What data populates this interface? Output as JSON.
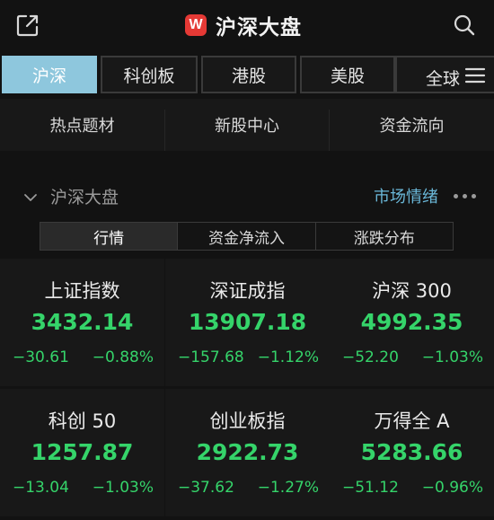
{
  "header": {
    "logo_text": "W",
    "title": "沪深大盘",
    "share_icon": "share-external-icon",
    "search_icon": "search-icon"
  },
  "market_tabs": [
    {
      "label": "沪深",
      "active": true
    },
    {
      "label": "科创板",
      "active": false
    },
    {
      "label": "港股",
      "active": false
    },
    {
      "label": "美股",
      "active": false
    },
    {
      "label": "全球",
      "active": false
    }
  ],
  "shortcuts": [
    "热点题材",
    "新股中心",
    "资金流向"
  ],
  "section": {
    "title": "沪深大盘",
    "link": "市场情绪"
  },
  "sub_tabs": [
    {
      "label": "行情",
      "active": true
    },
    {
      "label": "资金净流入",
      "active": false
    },
    {
      "label": "涨跌分布",
      "active": false
    }
  ],
  "indices": [
    {
      "name": "上证指数",
      "price": "3432.14",
      "change": "−30.61",
      "pct": "−0.88%"
    },
    {
      "name": "深证成指",
      "price": "13907.18",
      "change": "−157.68",
      "pct": "−1.12%"
    },
    {
      "name": "沪深 300",
      "price": "4992.35",
      "change": "−52.20",
      "pct": "−1.03%"
    },
    {
      "name": "科创 50",
      "price": "1257.87",
      "change": "−13.04",
      "pct": "−1.03%"
    },
    {
      "name": "创业板指",
      "price": "2922.73",
      "change": "−37.62",
      "pct": "−1.27%"
    },
    {
      "name": "万得全 A",
      "price": "5283.66",
      "change": "−51.12",
      "pct": "−0.96%"
    }
  ],
  "colors": {
    "background": "#121212",
    "accent": "#8ec7dd",
    "link": "#6ab7d8",
    "down": "#35d46a",
    "logo": "#e53935"
  }
}
